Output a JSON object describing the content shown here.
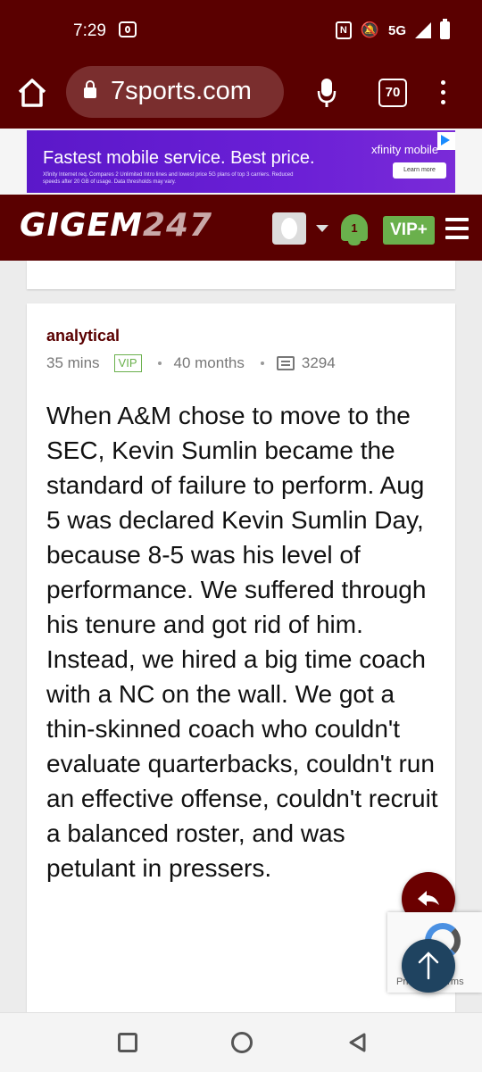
{
  "status_bar": {
    "time": "7:29",
    "network": "5G",
    "nfc_label": "N"
  },
  "browser": {
    "url": "7sports.com",
    "tab_count": "70"
  },
  "ad": {
    "headline": "Fastest mobile service. Best price.",
    "fine_print": "Xfinity Internet req. Compares 2 Unlimited Intro lines and lowest price 5G plans of top 3 carriers. Reduced speeds after 20 GB of usage. Data thresholds may vary.",
    "brand": "xfinity mobile",
    "cta": "Learn more",
    "close": "✕",
    "colors": {
      "background": "#6a1fd6"
    }
  },
  "site_header": {
    "logo_main": "GIGEM",
    "logo_num": "247",
    "notification_count": "1",
    "vip_label": "VIP+"
  },
  "post": {
    "username": "analytical",
    "time_ago": "35 mins",
    "badge": "VIP",
    "tenure": "40 months",
    "post_count": "3294",
    "body": "When A&M chose to move to the SEC, Kevin Sumlin became the standard of failure to perform. Aug 5 was declared Kevin Sumlin Day, because 8-5 was his level of performance. We suffered through his tenure and got rid of him. Instead, we hired a big time coach with a NC on the wall. We got a thin-skinned coach who couldn't evaluate quarterbacks, couldn't run an effective offense, couldn't recruit a balanced roster, and was petulant in pressers."
  },
  "captcha": {
    "text": "Privacy - Terms"
  },
  "colors": {
    "brand_maroon": "#5a0000",
    "vip_green": "#6ab04c"
  }
}
